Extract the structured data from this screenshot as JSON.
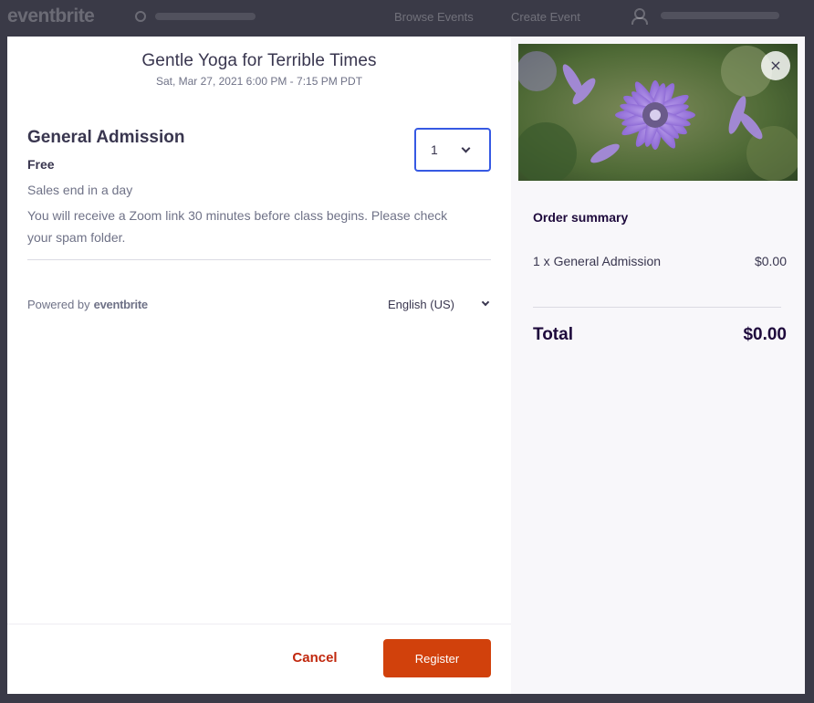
{
  "background": {
    "logo": "eventbrite",
    "nav_browse": "Browse Events",
    "nav_create": "Create Event",
    "icons": {
      "search": "search-icon",
      "user": "user-icon"
    }
  },
  "event": {
    "title": "Gentle Yoga for Terrible Times",
    "datetime": "Sat, Mar 27, 2021 6:00 PM - 7:15 PM PDT"
  },
  "ticket": {
    "name": "General Admission",
    "price": "Free",
    "sales_end": "Sales end in a day",
    "description": "You will receive a Zoom link  30 minutes before class begins. Please check your spam folder.",
    "quantity": "1"
  },
  "footer": {
    "powered_by": "Powered by",
    "brand": "eventbrite",
    "language": "English (US)",
    "cancel_label": "Cancel",
    "register_label": "Register"
  },
  "order_summary": {
    "title": "Order summary",
    "line_item_label": "1 x General Admission",
    "line_item_price": "$0.00",
    "total_label": "Total",
    "total_value": "$0.00"
  },
  "close_label": "×",
  "colors": {
    "accent": "#3659e3",
    "register": "#d1410c",
    "cancel": "#c1280e",
    "text": "#39364f",
    "muted": "#6f7287"
  }
}
